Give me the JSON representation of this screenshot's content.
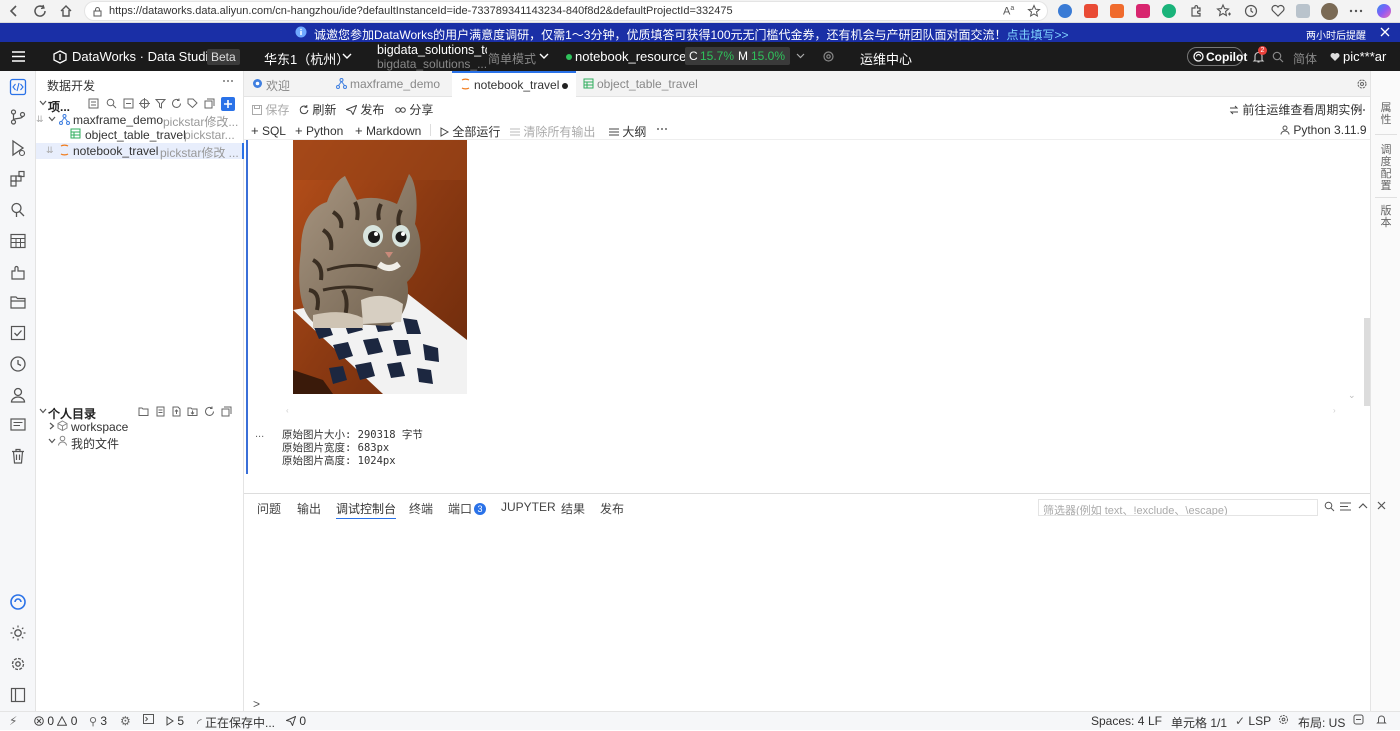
{
  "browser": {
    "url": "https://dataworks.data.aliyun.com/cn-hangzhou/ide?defaultInstanceId=ide-733789341143234-840f8d2&defaultProjectId=332475"
  },
  "banner": {
    "text": "诚邀您参加DataWorks的用户满意度调研，仅需1～3分钟，优质填答可获得100元无门槛代金券，还有机会与产研团队面对面交流！",
    "link": "点击填写>>",
    "right": "两小时后提醒"
  },
  "header": {
    "title": "DataWorks · Data Studio",
    "beta": "Beta",
    "region": "华东1（杭州）",
    "workspace_line1": "bigdata_solutions_tc",
    "workspace_line2": "bigdata_solutions_...",
    "mode": "简单模式",
    "resource": "notebook_resource",
    "cpu_label": "C",
    "cpu": "15.7%",
    "mem_label": "M",
    "mem": "15.0%",
    "ops": "运维中心",
    "copilot": "Copilot",
    "notif_count": "2",
    "lang": "简体",
    "user": "pic***ar"
  },
  "explorer": {
    "title": "数据开发",
    "project_label": "项...",
    "items": [
      {
        "name": "maxframe_demo",
        "owner": "pickstar修改..."
      },
      {
        "name": "object_table_travel",
        "owner": "pickstar..."
      },
      {
        "name": "notebook_travel",
        "owner": "pickstar修改 ..."
      }
    ],
    "personal": "个人目录",
    "workspace": "workspace",
    "my_files": "我的文件"
  },
  "tabs": [
    {
      "label": "欢迎"
    },
    {
      "label": "maxframe_demo"
    },
    {
      "label": "notebook_travel"
    },
    {
      "label": "object_table_travel"
    }
  ],
  "toolbar": {
    "save": "保存",
    "refresh": "刷新",
    "publish": "发布",
    "share": "分享",
    "goto_ops": "前往运维查看周期实例",
    "sql": "SQL",
    "python": "Python",
    "markdown": "Markdown",
    "run_all": "全部运行",
    "clear_output": "清除所有输出",
    "outline": "大纲",
    "kernel": "Python 3.11.9"
  },
  "rail": {
    "props": "属性",
    "schedule": "调度配置",
    "version": "版本"
  },
  "output": {
    "ellipsis": "...",
    "line1": "原始图片大小: 290318 字节",
    "line2": "原始图片宽度: 683px",
    "line3": "原始图片高度: 1024px"
  },
  "panel": {
    "tabs": [
      "问题",
      "输出",
      "调试控制台",
      "终端",
      "端口",
      "JUPYTER",
      "结果",
      "发布"
    ],
    "ports_badge": "3",
    "filter_placeholder": "筛选器(例如 text、!exclude、\\escape)",
    "prompt": ">"
  },
  "status": {
    "errors": "0",
    "warnings": "0",
    "ports": "3",
    "runs": "5",
    "saving": "正在保存中...",
    "sends": "0",
    "spaces": "Spaces: 4",
    "eol": "LF",
    "cells": "单元格 1/1",
    "lsp": "LSP",
    "layout": "布局: US"
  },
  "colors": {
    "accent": "#2a72e8",
    "banner": "#1a2fa6",
    "header": "#1b1b1b",
    "active_cell": "#3a6fd8"
  }
}
